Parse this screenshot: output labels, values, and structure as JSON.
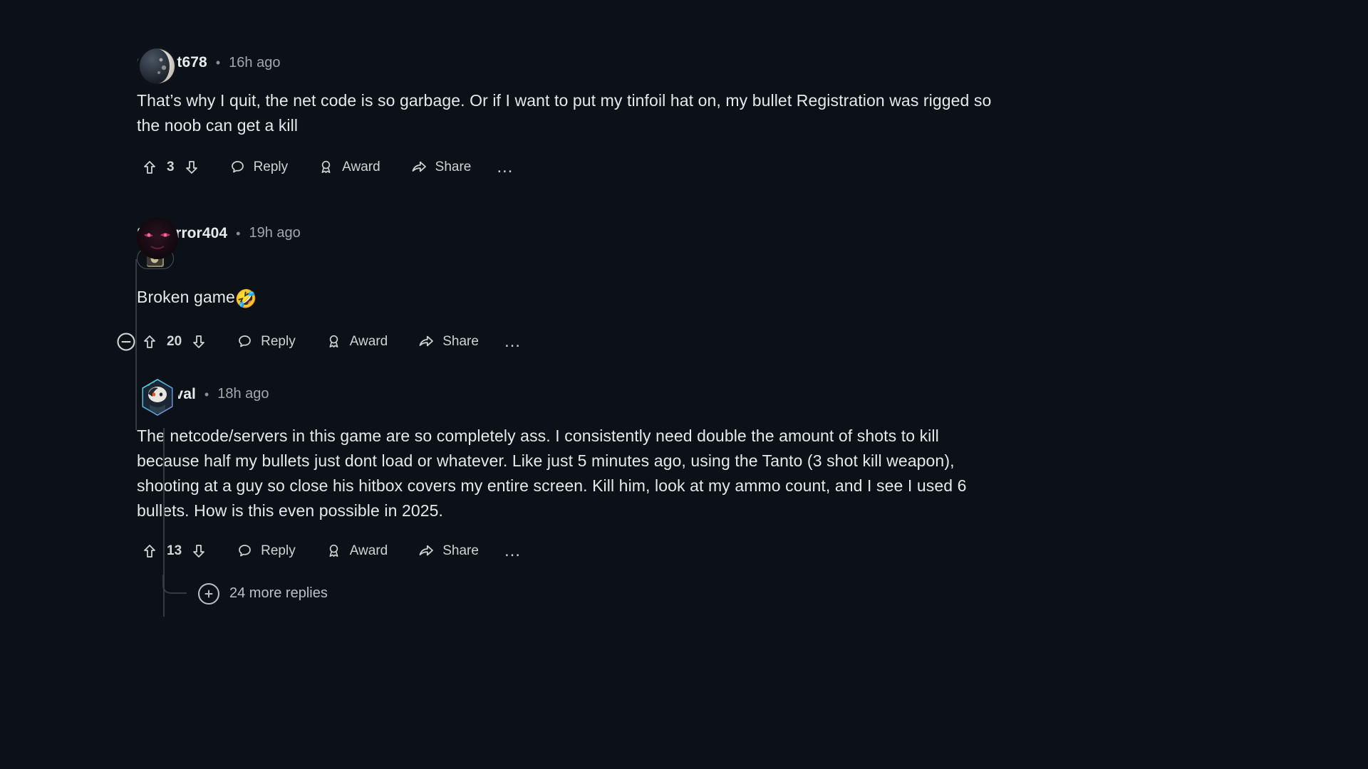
{
  "theme": {
    "background": "#0c1117",
    "text_primary": "#e3e9ec",
    "text_secondary": "#9fa8ad",
    "thread_line": "#343b41"
  },
  "comments": [
    {
      "id": "comment-gohst678",
      "username": "GohSt678",
      "separator": "•",
      "timestamp": "16h ago",
      "body": "That’s why I quit, the net code is so garbage. Or if I want to put my tinfoil hat on, my bullet Registration was rigged so the noob can get a kill",
      "vote_count": "3",
      "actions": {
        "reply": "Reply",
        "award": "Award",
        "share": "Share",
        "more": "…"
      }
    },
    {
      "id": "comment-suberror404",
      "username": "SubError404",
      "separator": "•",
      "timestamp": "19h ago",
      "body": "Broken game",
      "body_emoji": "🤣",
      "vote_count": "20",
      "has_award_badge": true,
      "actions": {
        "reply": "Reply",
        "award": "Award",
        "share": "Share",
        "more": "…"
      }
    },
    {
      "id": "comment-sirvyval",
      "username": "SirVyval",
      "separator": "•",
      "timestamp": "18h ago",
      "body": "The netcode/servers in this game are so completely ass. I consistently need double the amount of shots to kill because half my bullets just dont load or whatever. Like just 5 minutes ago, using the Tanto (3 shot kill weapon), shooting at a guy so close his hitbox covers my entire screen. Kill him, look at my ammo count, and I see I used 6 bullets. How is this even possible in 2025.",
      "vote_count": "13",
      "actions": {
        "reply": "Reply",
        "award": "Award",
        "share": "Share",
        "more": "…"
      }
    }
  ],
  "more_replies": {
    "label": "24 more replies",
    "count": "24"
  }
}
